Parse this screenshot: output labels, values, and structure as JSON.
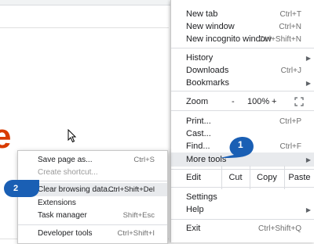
{
  "menu": {
    "new_tab": {
      "label": "New tab",
      "shortcut": "Ctrl+T"
    },
    "new_window": {
      "label": "New window",
      "shortcut": "Ctrl+N"
    },
    "new_incognito": {
      "label": "New incognito window",
      "shortcut": "Ctrl+Shift+N"
    },
    "history": {
      "label": "History"
    },
    "downloads": {
      "label": "Downloads",
      "shortcut": "Ctrl+J"
    },
    "bookmarks": {
      "label": "Bookmarks"
    },
    "zoom": {
      "label": "Zoom",
      "minus": "-",
      "value": "100%",
      "plus": "+"
    },
    "print": {
      "label": "Print...",
      "shortcut": "Ctrl+P"
    },
    "cast": {
      "label": "Cast..."
    },
    "find": {
      "label": "Find...",
      "shortcut": "Ctrl+F"
    },
    "more_tools": {
      "label": "More tools"
    },
    "edit": {
      "label": "Edit",
      "cut": "Cut",
      "copy": "Copy",
      "paste": "Paste"
    },
    "settings": {
      "label": "Settings"
    },
    "help": {
      "label": "Help"
    },
    "exit": {
      "label": "Exit",
      "shortcut": "Ctrl+Shift+Q"
    }
  },
  "submenu": {
    "save_page": {
      "label": "Save page as...",
      "shortcut": "Ctrl+S"
    },
    "create_shortcut": {
      "label": "Create shortcut..."
    },
    "clear_browsing": {
      "label": "Clear browsing data...",
      "shortcut": "Ctrl+Shift+Del"
    },
    "extensions": {
      "label": "Extensions"
    },
    "task_manager": {
      "label": "Task manager",
      "shortcut": "Shift+Esc"
    },
    "developer_tools": {
      "label": "Developer tools",
      "shortcut": "Ctrl+Shift+I"
    }
  },
  "callouts": {
    "step1": "1",
    "step2": "2"
  },
  "page": {
    "logo_letter": "e"
  },
  "colors": {
    "callout": "#1a5fb4",
    "logo": "#d83b01",
    "highlight": "#e8eaed"
  }
}
